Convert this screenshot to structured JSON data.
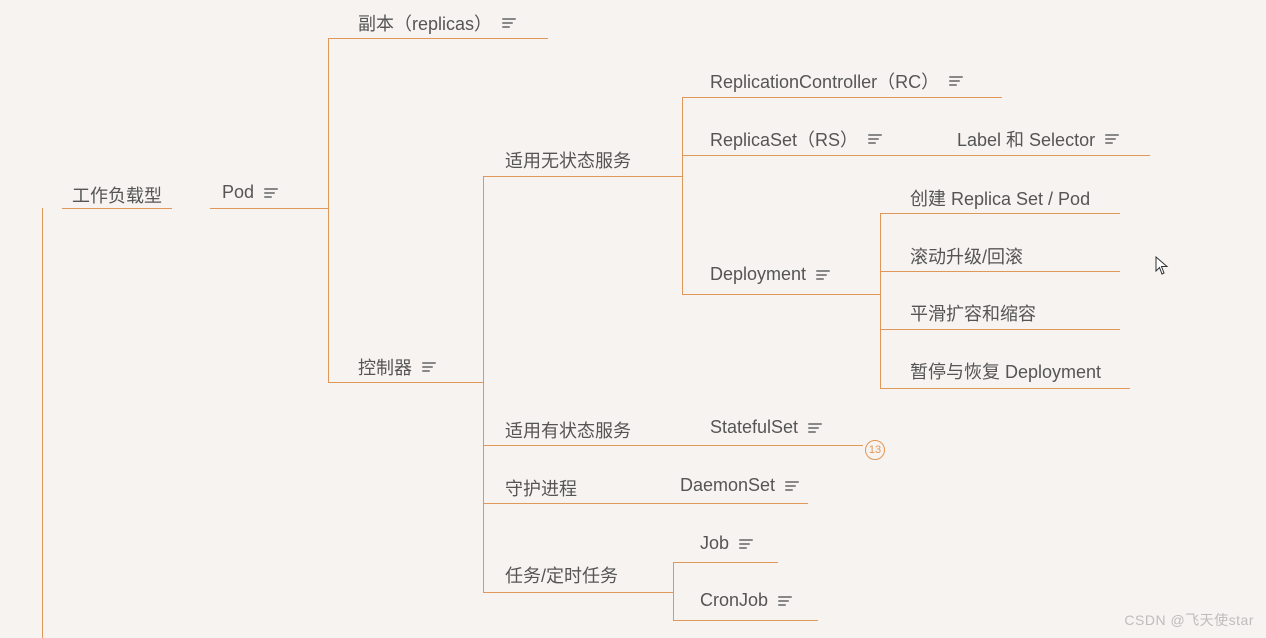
{
  "nodes": {
    "root": "工作负载型",
    "pod": "Pod",
    "replicas": "副本（replicas）",
    "controller": "控制器",
    "stateless": "适用无状态服务",
    "stateful": "适用有状态服务",
    "daemon": "守护进程",
    "jobs": "任务/定时任务",
    "rc": "ReplicationController（RC）",
    "rs": "ReplicaSet（RS）",
    "labelsel": "Label 和 Selector",
    "deployment": "Deployment",
    "dep_create": "创建 Replica Set / Pod",
    "dep_roll": "滚动升级/回滚",
    "dep_scale": "平滑扩容和缩容",
    "dep_pause": "暂停与恢复 Deployment",
    "statefulset": "StatefulSet",
    "daemonset": "DaemonSet",
    "job": "Job",
    "cronjob": "CronJob"
  },
  "badge": "13",
  "watermark": "CSDN @飞天使star"
}
